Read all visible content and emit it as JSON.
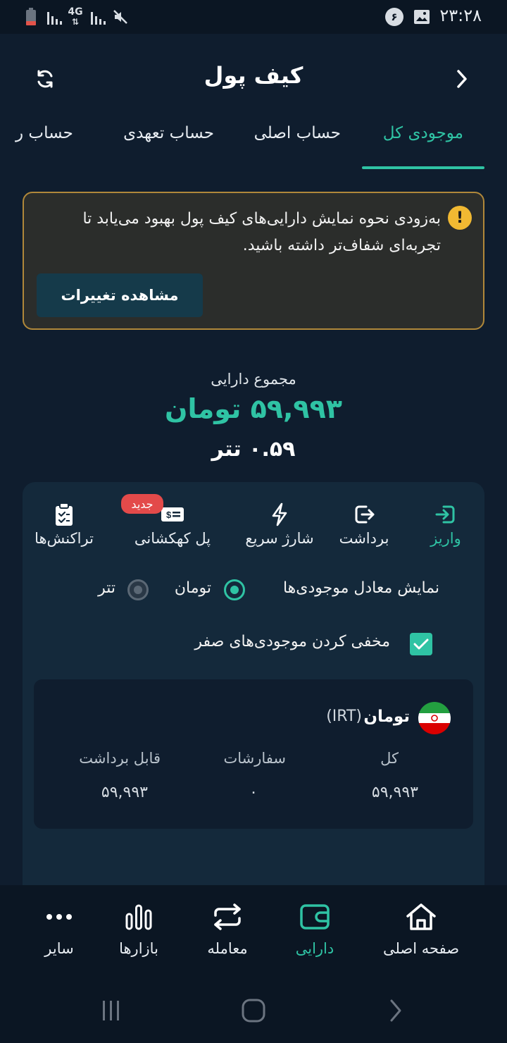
{
  "status_bar": {
    "time": "۲۳:۲۸",
    "notification_count": "۶",
    "network_label": "4G"
  },
  "header": {
    "title": "کیف پول"
  },
  "tabs": [
    {
      "label": "موجودی کل",
      "active": true
    },
    {
      "label": "حساب اصلی",
      "active": false
    },
    {
      "label": "حساب تعهدی",
      "active": false
    },
    {
      "label": "حساب ر",
      "active": false
    }
  ],
  "notice": {
    "text": "به‌زودی نحوه نمایش دارایی‌های کیف پول بهبود می‌یابد تا تجربه‌ای شفاف‌تر داشته باشید.",
    "button_label": "مشاهده تغییرات"
  },
  "totals": {
    "label": "مجموع دارایی",
    "toman": "۵۹,۹۹۳ تومان",
    "tether": "۰.۵۹ تتر"
  },
  "actions": [
    {
      "label": "واریز",
      "icon": "deposit-icon",
      "active": true
    },
    {
      "label": "برداشت",
      "icon": "withdraw-icon",
      "active": false
    },
    {
      "label": "شارژ سریع",
      "icon": "lightning-icon",
      "active": false
    },
    {
      "label": "پل کهکشانی",
      "icon": "bridge-icon",
      "active": false,
      "badge": "جدید"
    },
    {
      "label": "تراکنش‌ها",
      "icon": "clipboard-icon",
      "active": false
    }
  ],
  "display_options": {
    "label": "نمایش معادل موجودی‌ها",
    "options": [
      "تومان",
      "تتر"
    ],
    "selected": "تومان"
  },
  "hide_zero": {
    "label": "مخفی کردن موجودی‌های صفر",
    "checked": true
  },
  "asset": {
    "name": "تومان",
    "code": "(IRT)",
    "columns": [
      {
        "label": "کل",
        "value": "۵۹,۹۹۳"
      },
      {
        "label": "سفارشات",
        "value": "۰"
      },
      {
        "label": "قابل برداشت",
        "value": "۵۹,۹۹۳"
      }
    ]
  },
  "bottom_nav": [
    {
      "label": "صفحه اصلی",
      "icon": "home-icon",
      "active": false
    },
    {
      "label": "دارایی",
      "icon": "wallet-icon",
      "active": true
    },
    {
      "label": "معامله",
      "icon": "exchange-icon",
      "active": false
    },
    {
      "label": "بازارها",
      "icon": "chart-icon",
      "active": false
    },
    {
      "label": "سایر",
      "icon": "more-icon",
      "active": false
    }
  ],
  "colors": {
    "accent": "#2fc3a4",
    "background": "#0f1d2e",
    "card": "#14293b",
    "warning": "#f1b932",
    "badge": "#e34a4a"
  }
}
